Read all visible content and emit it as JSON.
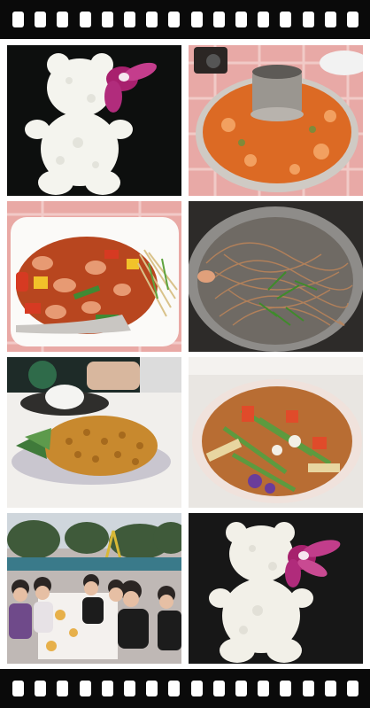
{
  "photos": [
    {
      "name": "rice-teddy-bear",
      "bg": "#0d0f0e"
    },
    {
      "name": "tom-yum-hotpot",
      "bg": "#e8a9a6"
    },
    {
      "name": "stir-fry-prawns",
      "bg": "#e9a9a5"
    },
    {
      "name": "glass-noodles-pan",
      "bg": "#2d2b29"
    },
    {
      "name": "pineapple-fried-rice",
      "bg": "#f1efec"
    },
    {
      "name": "vegetable-salad-plate",
      "bg": "#e9e6e2"
    },
    {
      "name": "group-dinner-table",
      "bg": "#bfb8b5"
    },
    {
      "name": "rice-teddy-bear-2",
      "bg": "#171717"
    }
  ]
}
